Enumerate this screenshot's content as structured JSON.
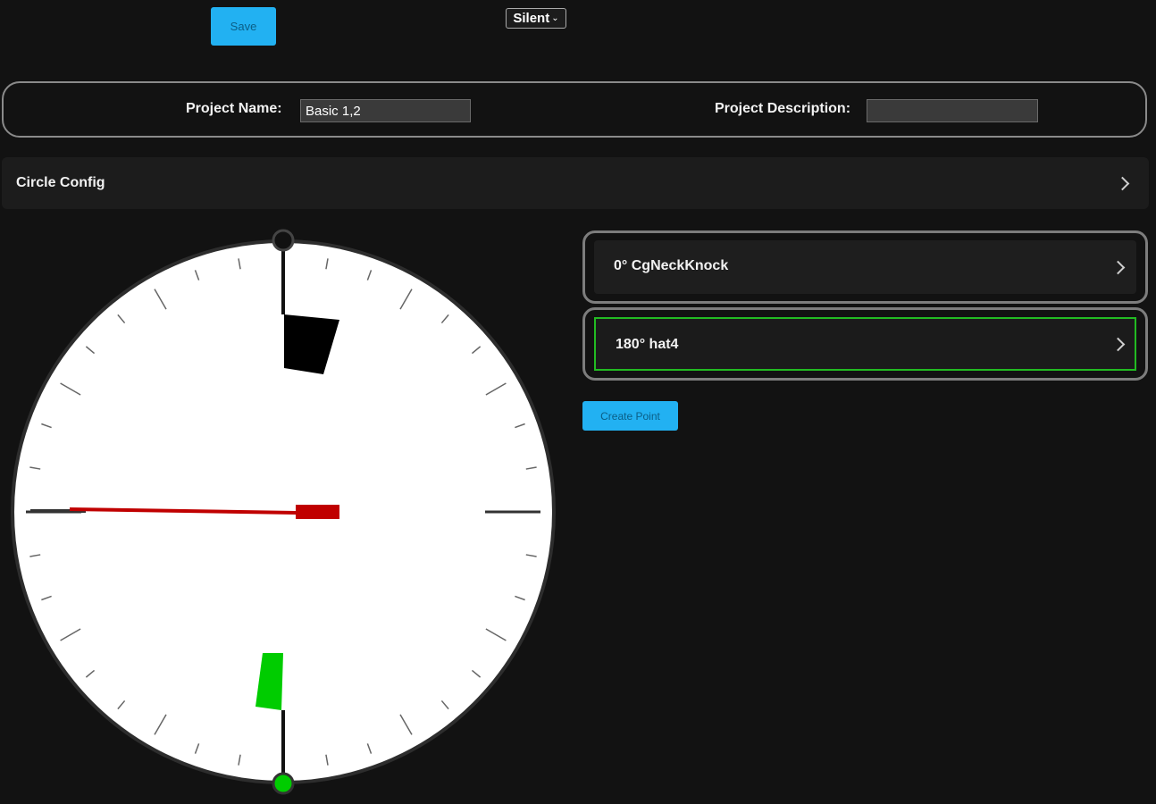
{
  "toolbar": {
    "save_label": "Save",
    "mode_select_value": "Silent"
  },
  "project": {
    "name_label": "Project Name:",
    "name_value": "Basic 1,2",
    "description_label": "Project Description:",
    "description_value": ""
  },
  "circle_config": {
    "title": "Circle Config"
  },
  "points": [
    {
      "label": "0° CgNeckKnock",
      "selected": false
    },
    {
      "label": "180° hat4",
      "selected": true
    }
  ],
  "create_point_label": "Create Point",
  "colors": {
    "accent": "#22b1f2",
    "selected_border": "#22bb22",
    "needle": "#c00000",
    "marker_top": "#000000",
    "marker_bottom": "#00cc00"
  },
  "dial": {
    "needle_angle_deg": 270,
    "markers": [
      {
        "angle_deg": 0,
        "color": "#000000"
      },
      {
        "angle_deg": 180,
        "color": "#00cc00"
      }
    ]
  }
}
